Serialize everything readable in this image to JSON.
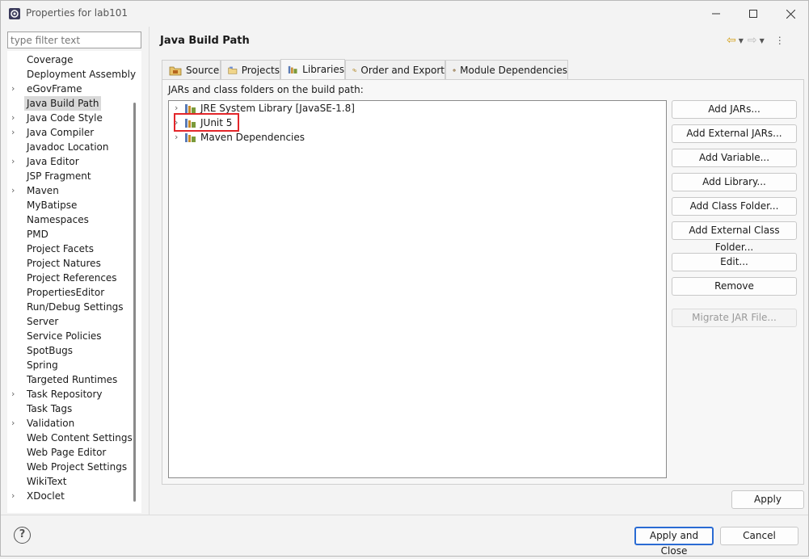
{
  "window": {
    "title": "Properties for lab101"
  },
  "filter": {
    "placeholder": "type filter text"
  },
  "sidebar": {
    "items": [
      {
        "label": "Coverage",
        "expandable": false
      },
      {
        "label": "Deployment Assembly",
        "expandable": false
      },
      {
        "label": "eGovFrame",
        "expandable": true
      },
      {
        "label": "Java Build Path",
        "expandable": false,
        "selected": true
      },
      {
        "label": "Java Code Style",
        "expandable": true
      },
      {
        "label": "Java Compiler",
        "expandable": true
      },
      {
        "label": "Javadoc Location",
        "expandable": false
      },
      {
        "label": "Java Editor",
        "expandable": true
      },
      {
        "label": "JSP Fragment",
        "expandable": false
      },
      {
        "label": "Maven",
        "expandable": true
      },
      {
        "label": "MyBatipse",
        "expandable": false
      },
      {
        "label": "Namespaces",
        "expandable": false
      },
      {
        "label": "PMD",
        "expandable": false
      },
      {
        "label": "Project Facets",
        "expandable": false
      },
      {
        "label": "Project Natures",
        "expandable": false
      },
      {
        "label": "Project References",
        "expandable": false
      },
      {
        "label": "PropertiesEditor",
        "expandable": false
      },
      {
        "label": "Run/Debug Settings",
        "expandable": false
      },
      {
        "label": "Server",
        "expandable": false
      },
      {
        "label": "Service Policies",
        "expandable": false
      },
      {
        "label": "SpotBugs",
        "expandable": false
      },
      {
        "label": "Spring",
        "expandable": false
      },
      {
        "label": "Targeted Runtimes",
        "expandable": false
      },
      {
        "label": "Task Repository",
        "expandable": true
      },
      {
        "label": "Task Tags",
        "expandable": false
      },
      {
        "label": "Validation",
        "expandable": true
      },
      {
        "label": "Web Content Settings",
        "expandable": false
      },
      {
        "label": "Web Page Editor",
        "expandable": false
      },
      {
        "label": "Web Project Settings",
        "expandable": false
      },
      {
        "label": "WikiText",
        "expandable": false
      },
      {
        "label": "XDoclet",
        "expandable": true
      }
    ]
  },
  "main": {
    "title": "Java Build Path",
    "tabs": [
      {
        "label": "Source",
        "icon": "source-folder-icon"
      },
      {
        "label": "Projects",
        "icon": "projects-icon"
      },
      {
        "label": "Libraries",
        "icon": "libraries-icon",
        "active": true
      },
      {
        "label": "Order and Export",
        "icon": "order-export-icon"
      },
      {
        "label": "Module Dependencies",
        "icon": "module-icon"
      }
    ],
    "section_label": "JARs and class folders on the build path:",
    "build_path": [
      {
        "label": "JRE System Library [JavaSE-1.8]"
      },
      {
        "label": "JUnit 5",
        "highlighted": true
      },
      {
        "label": "Maven Dependencies"
      }
    ],
    "buttons": {
      "add_jars": "Add JARs...",
      "add_external_jars": "Add External JARs...",
      "add_variable": "Add Variable...",
      "add_library": "Add Library...",
      "add_class_folder": "Add Class Folder...",
      "add_external_class_folder": "Add External Class Folder...",
      "edit": "Edit...",
      "remove": "Remove",
      "migrate_jar": "Migrate JAR File..."
    },
    "apply": "Apply"
  },
  "footer": {
    "apply_close": "Apply and Close",
    "cancel": "Cancel"
  },
  "colors": {
    "highlight": "#e3262a",
    "default_button_border": "#2a6bd3",
    "nav_arrow": "#d4a017"
  }
}
